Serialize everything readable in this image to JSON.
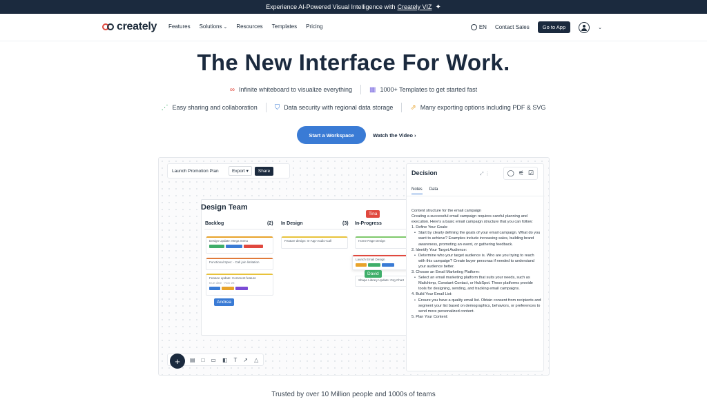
{
  "banner": {
    "prefix": "Experience AI-Powered Visual Intelligence with",
    "link": "Creately VIZ",
    "spark": "✦"
  },
  "nav": {
    "logo": "creately",
    "menu": [
      "Features",
      "Solutions",
      "Resources",
      "Templates",
      "Pricing"
    ],
    "solutions_caret": "⌄",
    "lang": "EN",
    "contact": "Contact Sales",
    "go_to_app": "Go to App",
    "account_caret": "⌄"
  },
  "hero": {
    "title": "The New Interface For Work.",
    "features_row1": [
      {
        "icon": "∞",
        "text": "Infinite whiteboard to visualize everything"
      },
      {
        "icon": "▦",
        "text": "1000+ Templates to get started fast"
      }
    ],
    "features_row2": [
      {
        "icon": "⋰",
        "text": "Easy sharing and collaboration"
      },
      {
        "icon": "⛉",
        "text": "Data security with regional data storage"
      },
      {
        "icon": "⇗",
        "text": "Many exporting options including PDF & SVG"
      }
    ],
    "cta": "Start a Workspace",
    "watch": "Watch the Video",
    "watch_arrow": "›"
  },
  "demo": {
    "doc_title": "Launch Promotion Plan",
    "export": "Export ▾",
    "share": "Share",
    "board_title": "Design Team",
    "columns": [
      {
        "name": "Backlog",
        "count": "(2)"
      },
      {
        "name": "In Design",
        "count": "(3)"
      },
      {
        "name": "In-Progress",
        "count": ""
      }
    ],
    "cards": {
      "c1": "Design Update: Mega menu",
      "c2": "Functional Spec: - Call join limitation",
      "c3": "Feature update: Comment feature",
      "c3_meta": "Due date · Nov 26",
      "c4": "Feature design: In-App-Audio-Call",
      "c5": "Home Page Design",
      "c6": "Launch Email Design",
      "c7": "Shape Library Update: Org Chart"
    },
    "cursors": {
      "tina": "Tina",
      "andrea": "Andrea",
      "david": "David"
    },
    "panel": {
      "title": "Decision",
      "tab_notes": "Notes",
      "tab_data": "Data",
      "expand": "⤢ ⋮",
      "tool_icons": [
        "◯",
        "⚟",
        "☑"
      ],
      "lines": [
        "Content structure for the email campaign",
        "Creating a successful email campaign requires careful planning and execution. Here's a basic email campaign structure that you can follow:",
        "1. Define Your Goals:",
        "Start by clearly defining the goals of your email campaign. What do you want to achieve? Examples include increasing sales, building brand awareness, promoting an event, or gathering feedback.",
        "2. Identify Your Target Audience:",
        "Determine who your target audience is. Who are you trying to reach with this campaign? Create buyer personas if needed to understand your audience better.",
        "3. Choose an Email Marketing Platform:",
        "Select an email marketing platform that suits your needs, such as Mailchimp, Constant Contact, or HubSpot. These platforms provide tools for designing, sending, and tracking email campaigns.",
        "4. Build Your Email List:",
        "Ensure you have a quality email list. Obtain consent from recipients and segment your list based on demographics, behaviors, or preferences to send more personalized content.",
        "5. Plan Your Content:"
      ]
    },
    "toolbar_icons": [
      "▤",
      "□",
      "▭",
      "◧",
      "T",
      "↗",
      "△"
    ],
    "plus": "+"
  },
  "trusted": "Trusted by over 10 Million people and 1000s of teams",
  "colors": {
    "navy": "#1b2a3e",
    "accent": "#3a7bd5",
    "red": "#e0483e"
  }
}
